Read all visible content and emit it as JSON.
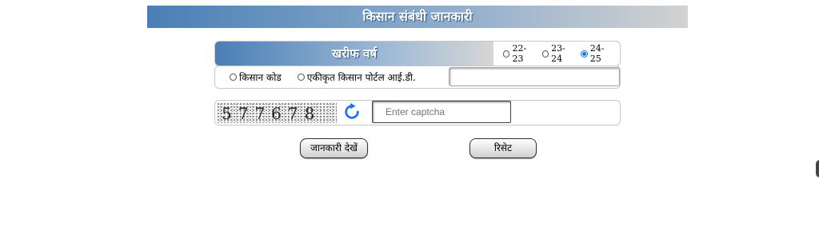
{
  "header": {
    "title": "किसान संबंधी जानकारी"
  },
  "season": {
    "title": "खरीफ वर्ष",
    "years": [
      {
        "label": "22-23",
        "selected": false
      },
      {
        "label": "23-24",
        "selected": false
      },
      {
        "label": "24-25",
        "selected": true
      }
    ]
  },
  "id_type": {
    "options": [
      {
        "label": "किसान कोड",
        "selected": false
      },
      {
        "label": "एकीकृत किसान पोर्टल आई.डी.",
        "selected": false
      }
    ],
    "input_value": ""
  },
  "captcha": {
    "text": "577678",
    "placeholder": "Enter captcha",
    "refresh_icon": "refresh-icon"
  },
  "buttons": {
    "view": "जानकारी देखें",
    "reset": "रिसेट"
  },
  "colors": {
    "header_start": "#4a7fb5",
    "header_end": "#d2d2d2",
    "refresh_blue": "#1a73e8"
  }
}
